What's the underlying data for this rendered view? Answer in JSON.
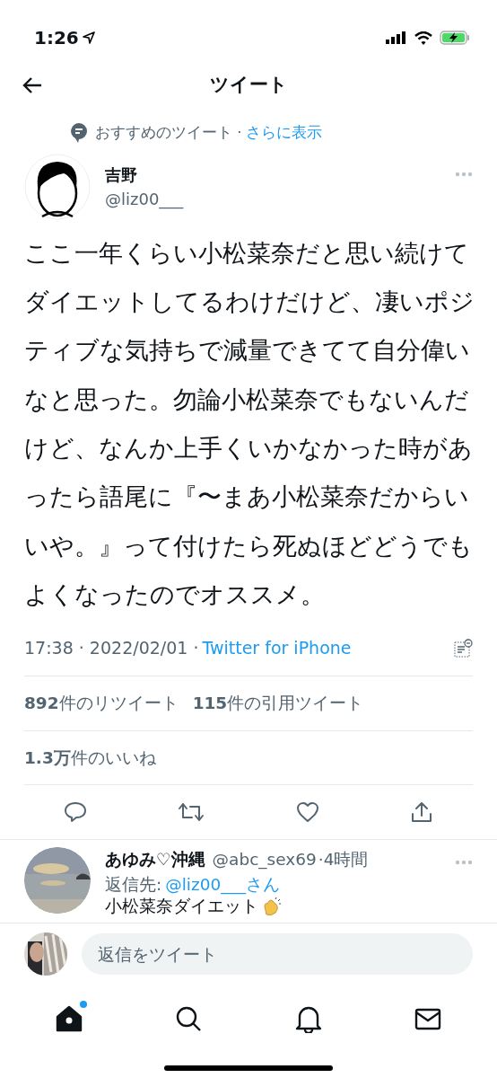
{
  "status_bar": {
    "time": "1:26"
  },
  "header": {
    "title": "ツイート"
  },
  "promoted": {
    "label": "おすすめのツイート ·",
    "link": "さらに表示"
  },
  "tweet": {
    "name": "吉野",
    "handle": "@liz00___",
    "text": "ここ一年くらい小松菜奈だと思い続けてダイエットしてるわけだけど、凄いポジティブな気持ちで減量できてて自分偉いなと思った。勿論小松菜奈でもないんだけど、なんか上手くいかなかった時があったら語尾に『〜まあ小松菜奈だからいいや。』って付けたら死ぬほどどうでもよくなったのでオススメ。",
    "timestamp": "17:38 · 2022/02/01 ·",
    "source": "Twitter for iPhone",
    "stats": [
      "**892**件のリツイート",
      "**115**件の引用ツイート"
    ],
    "likes": "**1.3万**件のいいね"
  },
  "reply": {
    "name": "あゆみ♡沖縄",
    "handle": "@abc_sex69",
    "time": "·4時間",
    "reply_to_label": "返信先:",
    "reply_to": "@liz00___さん",
    "text": "小松菜奈ダイエット"
  },
  "compose": {
    "placeholder": "返信をツイート"
  },
  "tab_bar": {
    "items": [
      {
        "kind": "home",
        "selected": true,
        "dot": true
      },
      {
        "kind": "search",
        "selected": false,
        "dot": false
      },
      {
        "kind": "notifications",
        "selected": false,
        "dot": false
      },
      {
        "kind": "messages",
        "selected": false,
        "dot": false
      }
    ]
  }
}
